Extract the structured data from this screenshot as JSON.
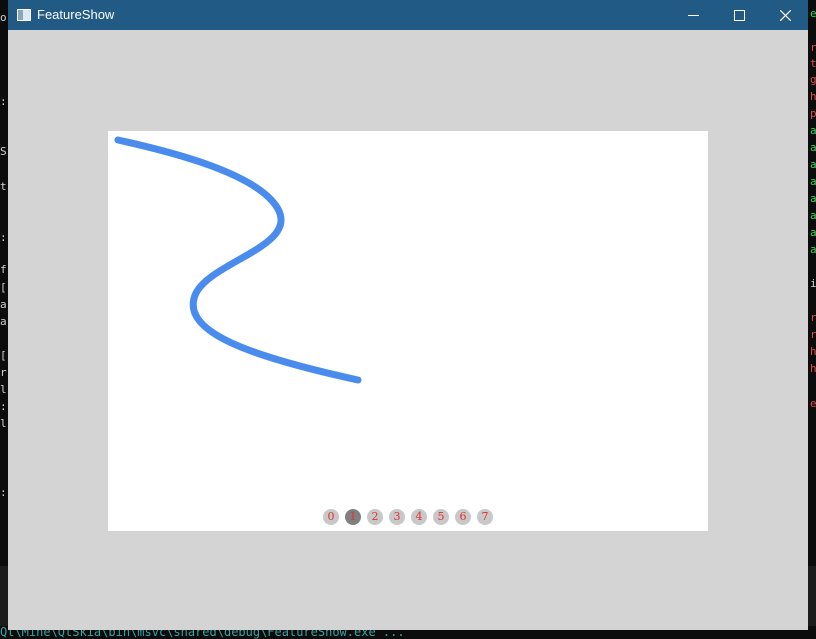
{
  "console": {
    "left_fragments": [
      "o",
      ":",
      "S",
      "t",
      ":",
      "f",
      "[",
      "a",
      "a",
      "[",
      "r",
      "l",
      ":",
      "l",
      ":"
    ],
    "right_fragments": [
      {
        "t": "e",
        "c": "#3ecf5a"
      },
      {
        "t": "r",
        "c": "#e04848"
      },
      {
        "t": "t",
        "c": "#e04848"
      },
      {
        "t": "g",
        "c": "#e04848"
      },
      {
        "t": "h",
        "c": "#e04848"
      },
      {
        "t": "p",
        "c": "#e04848"
      },
      {
        "t": "a",
        "c": "#3ecf5a"
      },
      {
        "t": "a",
        "c": "#3ecf5a"
      },
      {
        "t": "a",
        "c": "#3ecf5a"
      },
      {
        "t": "a",
        "c": "#3ecf5a"
      },
      {
        "t": "a",
        "c": "#3ecf5a"
      },
      {
        "t": "a",
        "c": "#3ecf5a"
      },
      {
        "t": "a",
        "c": "#3ecf5a"
      },
      {
        "t": "a",
        "c": "#3ecf5a"
      },
      {
        "t": "i",
        "c": "#cfcfcf"
      },
      {
        "t": "r",
        "c": "#e04848"
      },
      {
        "t": "r",
        "c": "#e04848"
      },
      {
        "t": "h",
        "c": "#e04848"
      },
      {
        "t": "h",
        "c": "#e04848"
      },
      {
        "t": "e",
        "c": "#e04848"
      }
    ],
    "bottom_text": "Qt\\Mine\\QtSkia\\bin\\msvc\\shared\\debug\\FeatureShow.exe ..."
  },
  "window": {
    "title": "FeatureShow",
    "colors": {
      "titlebar": "#215a85",
      "client": "#d4d4d4",
      "canvas": "#ffffff",
      "curve": "#4a8ced"
    }
  },
  "pager": {
    "pages": [
      "0",
      "1",
      "2",
      "3",
      "4",
      "5",
      "6",
      "7"
    ],
    "active_index": 1
  }
}
